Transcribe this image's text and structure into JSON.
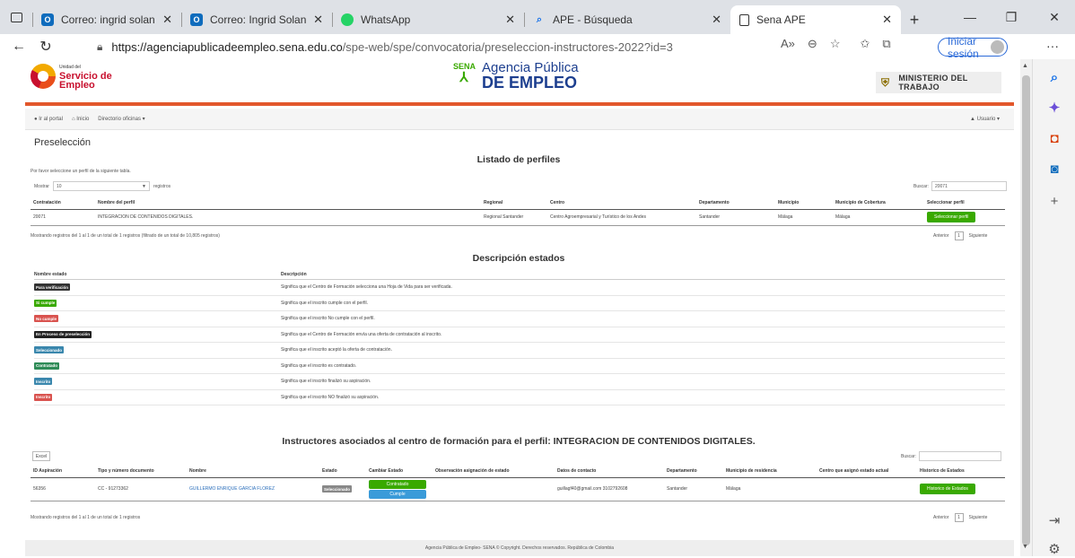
{
  "browser": {
    "tabs": [
      {
        "icon": "outlook-icon",
        "title": "Correo: ingrid solange seque",
        "active": false
      },
      {
        "icon": "outlook-icon",
        "title": "Correo: Ingrid Solange Seque",
        "active": false
      },
      {
        "icon": "whatsapp-icon",
        "title": "WhatsApp",
        "active": false
      },
      {
        "icon": "search-icon",
        "title": "APE - Búsqueda",
        "active": false
      },
      {
        "icon": "page-icon",
        "title": "Sena APE",
        "active": true
      }
    ],
    "url_host": "https://agenciapublicadeempleo.sena.edu.co",
    "url_path": "/spe-web/spe/convocatoria/preseleccion-instructores-2022?id=3",
    "signin_label": "Iniciar sesión"
  },
  "site": {
    "logo_left_small": "Unidad del",
    "logo_left_main": "Servicio de Empleo",
    "sena_label": "SENA",
    "ape_line1": "Agencia Pública",
    "ape_line2": "DE EMPLEO",
    "ministerio": "MINISTERIO DEL TRABAJO",
    "nav": {
      "portal": "Ir al portal",
      "inicio": "Inicio",
      "directorio": "Directorio oficinas ▾",
      "usuario": "Usuario ▾"
    }
  },
  "main": {
    "page_title": "Preselección",
    "perfiles_title": "Listado de perfiles",
    "instruction": "Por favor seleccione un perfil de la siguiente tabla.",
    "mostrar_label": "Mostrar",
    "mostrar_value": "10",
    "registros_label": "registros",
    "buscar_label": "Buscar:",
    "buscar_value": "20071",
    "perfiles_columns": [
      "Contratación",
      "Nombre del perfil",
      "Regional",
      "Centro",
      "Departamento",
      "Municipio",
      "Municipio de Cobertura",
      "Seleccionar perfil"
    ],
    "perfiles_row": {
      "contratacion": "20071",
      "nombre": "INTEGRACION DE CONTENIDOS DIGITALES.",
      "regional": "Regional Santander",
      "centro": "Centro Agroempresarial y Turístico de los Andes",
      "departamento": "Santander",
      "municipio": "Málaga",
      "cobertura": "Málaga",
      "button": "Seleccionar perfil"
    },
    "perfiles_info": "Mostrando registros del 1 al 1 de un total de 1 registros (filtrado de un total de 10,805 registros)",
    "pager": {
      "anterior": "Anterior",
      "page": "1",
      "siguiente": "Siguiente"
    },
    "estados_title": "Descripción estados",
    "estados_headers": [
      "Nombre estado",
      "Descripción"
    ],
    "estados": [
      {
        "label": "Para verificación",
        "color": "#333333",
        "desc": "Significa que el Centro de Formación selecciona una Hoja de Vida para ser verificada."
      },
      {
        "label": "Si cumple",
        "color": "#39a900",
        "desc": "Significa que el inscrito cumple con el perfil."
      },
      {
        "label": "No cumple",
        "color": "#d9534f",
        "desc": "Significa que el inscrito No cumple con el perfil."
      },
      {
        "label": "En Proceso de preselección",
        "color": "#222222",
        "desc": "Significa que el Centro de Formación envía una oferta de contratación al inscrito."
      },
      {
        "label": "Seleccionado",
        "color": "#3a87ad",
        "desc": "Significa que el inscrito aceptó la oferta de contratación."
      },
      {
        "label": "Contratado",
        "color": "#2e8b57",
        "desc": "Significa que el inscrito es contratado."
      },
      {
        "label": "Inscrito",
        "color": "#3a87ad",
        "desc": "Significa que el inscrito finalizó su aspiración."
      },
      {
        "label": "Inscrito",
        "color": "#d9534f",
        "desc": "Significa que el inscrito NO finalizó su aspiración."
      }
    ],
    "instructores_title": "Instructores asociados al centro de formación para el perfil: INTEGRACION DE CONTENIDOS DIGITALES.",
    "excel_label": "Excel",
    "instructores_columns": [
      "ID Aspiración",
      "Tipo y número documento",
      "Nombre",
      "Estado",
      "Cambiar Estado",
      "Observación asignación de estado",
      "Datos de contacto",
      "Departamento",
      "Municipio de residencia",
      "Centro que asignó estado actual",
      "Historico de Estados"
    ],
    "instructor_row": {
      "id": "56356",
      "documento": "CC - 91273362",
      "nombre": "GUILLERMO ENRIQUE GARCIA FLOREZ",
      "estado": "Seleccionado",
      "btn_contratado": "Contratado",
      "btn_cumple": "Cumple",
      "contacto": "guillagf40@gmail.com 3102792608",
      "departamento": "Santander",
      "municipio": "Málaga",
      "historico": "Historico de Estados"
    },
    "instructores_info": "Mostrando registros del 1 al 1 de un total de 1 registros",
    "footer": "Agencia Pública de Empleo- SENA © Copyright. Derechos reservados. República de Colombia"
  }
}
